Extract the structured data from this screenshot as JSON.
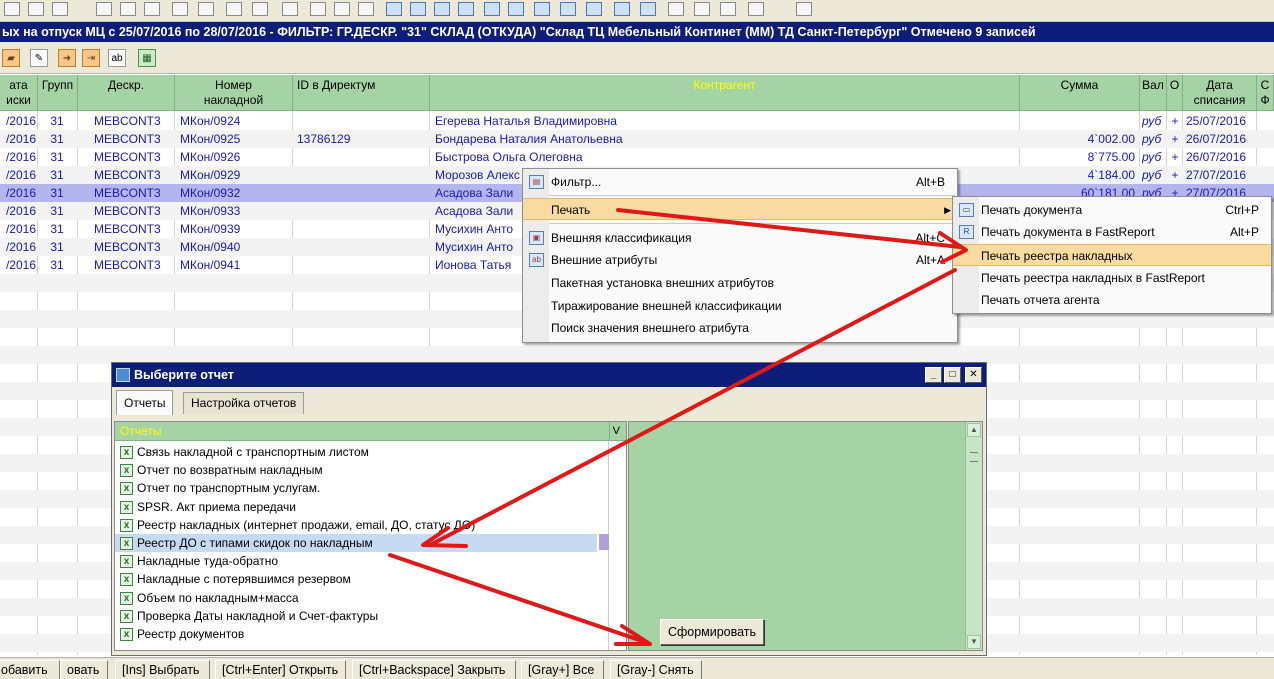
{
  "window": {
    "title": "ых на отпуск МЦ с 25/07/2016 по 28/07/2016 - ФИЛЬТР:  ГР.ДЕСКР. \"31\"  СКЛАД (ОТКУДА) \"Склад ТЦ Мебельный Континет (ММ) ТД Санкт-Петербург\"  Отмечено 9 записей"
  },
  "grid": {
    "headers": {
      "date": "ата\nиски",
      "group": "Групп",
      "descr": "Дескр.",
      "number": "Номер\nнакладной",
      "directum": "ID в Директум",
      "contragent": "Контрагент",
      "sum": "Сумма",
      "cur": "Вал",
      "o": "О",
      "wdate": "Дата\nсписания",
      "cf": "С\nФ"
    },
    "rows": [
      {
        "date": "/2016",
        "group": "31",
        "descr": "MEBCONT3",
        "number": "МКон/0924",
        "directum": "",
        "contragent": "Егерева Наталья Владимировна",
        "sum": "",
        "cur": "руб",
        "o": "+",
        "wdate": "25/07/2016"
      },
      {
        "date": "/2016",
        "group": "31",
        "descr": "MEBCONT3",
        "number": "МКон/0925",
        "directum": "13786129",
        "contragent": "Бондарева Наталия Анатольевна",
        "sum": "4`002.00",
        "cur": "руб",
        "o": "+",
        "wdate": "26/07/2016"
      },
      {
        "date": "/2016",
        "group": "31",
        "descr": "MEBCONT3",
        "number": "МКон/0926",
        "directum": "",
        "contragent": "Быстрова Ольга Олеговна",
        "sum": "8`775.00",
        "cur": "руб",
        "o": "+",
        "wdate": "26/07/2016"
      },
      {
        "date": "/2016",
        "group": "31",
        "descr": "MEBCONT3",
        "number": "МКон/0929",
        "directum": "",
        "contragent": "Морозов Алекс",
        "sum": "4`184.00",
        "cur": "руб",
        "o": "+",
        "wdate": "27/07/2016"
      },
      {
        "date": "/2016",
        "group": "31",
        "descr": "MEBCONT3",
        "number": "МКон/0932",
        "directum": "",
        "contragent": "Асадова Зали",
        "sum": "60`181.00",
        "cur": "руб",
        "o": "+",
        "wdate": "27/07/2016"
      },
      {
        "date": "/2016",
        "group": "31",
        "descr": "MEBCONT3",
        "number": "МКон/0933",
        "directum": "",
        "contragent": "Асадова Зали",
        "sum": "",
        "cur": "",
        "o": "",
        "wdate": ""
      },
      {
        "date": "/2016",
        "group": "31",
        "descr": "MEBCONT3",
        "number": "МКон/0939",
        "directum": "",
        "contragent": "Мусихин Анто",
        "sum": "",
        "cur": "",
        "o": "",
        "wdate": ""
      },
      {
        "date": "/2016",
        "group": "31",
        "descr": "MEBCONT3",
        "number": "МКон/0940",
        "directum": "",
        "contragent": "Мусихин Анто",
        "sum": "",
        "cur": "",
        "o": "",
        "wdate": ""
      },
      {
        "date": "/2016",
        "group": "31",
        "descr": "MEBCONT3",
        "number": "МКон/0941",
        "directum": "",
        "contragent": "Ионова Татья",
        "sum": "",
        "cur": "",
        "o": "",
        "wdate": ""
      }
    ]
  },
  "context_menu": {
    "items": [
      {
        "label": "Фильтр...",
        "shortcut": "Alt+B",
        "icon": "filter-icon"
      },
      {
        "label": "Печать",
        "shortcut": "",
        "icon": "",
        "submenu_arrow": "▶"
      },
      {
        "label": "Внешняя классификация",
        "shortcut": "Alt+C",
        "icon": "classification-icon"
      },
      {
        "label": "Внешние атрибуты",
        "shortcut": "Alt+A",
        "icon": "attributes-icon",
        "icon_text": "ab"
      },
      {
        "label": "Пакетная установка внешних атрибутов",
        "shortcut": ""
      },
      {
        "label": "Тиражирование внешней классификации",
        "shortcut": ""
      },
      {
        "label": "Поиск значения внешнего атрибута",
        "shortcut": ""
      }
    ]
  },
  "submenu": {
    "items": [
      {
        "label": "Печать документа",
        "shortcut": "Ctrl+P",
        "icon": "printer-icon"
      },
      {
        "label": "Печать документа в FastReport",
        "shortcut": "Alt+P",
        "icon": "fastreport-icon"
      },
      {
        "label": "Печать реестра накладных",
        "shortcut": ""
      },
      {
        "label": "Печать реестра накладных в FastReport",
        "shortcut": ""
      },
      {
        "label": "Печать отчета агента",
        "shortcut": ""
      }
    ]
  },
  "dialog": {
    "title": "Выберите отчет",
    "tabs": [
      "Отчеты",
      "Настройка отчетов"
    ],
    "list_header": "Отчеты",
    "list_col_v": "V",
    "items": [
      "Связь накладной с транспортным листом",
      "Отчет по возвратным накладным",
      "Отчет по транспортным услугам.",
      "SPSR. Акт приема передачи",
      "Реестр накладных (интернет продажи, email, ДО, статус ДО)",
      "Реестр ДО с типами скидок по накладным",
      "Накладные туда-обратно",
      "Накладные с потерявшимся резервом",
      "Объем по накладным+масса",
      "Проверка Даты накладной и Счет-фактуры",
      "Реестр документов"
    ],
    "selected_index": 5,
    "form_button": "Сформировать",
    "win_buttons": {
      "minimize": "_",
      "maximize": "□",
      "close": "✕"
    }
  },
  "bottombar": {
    "buttons": [
      "обавить",
      "овать",
      "[Ins] Выбрать",
      "[Ctrl+Enter] Открыть",
      "[Ctrl+Backspace] Закрыть",
      "[Gray+] Все",
      "[Gray-] Снять"
    ]
  },
  "colors": {
    "title_bg": "#0c1d7a",
    "grid_header": "#a6d3a6",
    "link_text": "#1818b8",
    "menu_highlight": "#f8dba0",
    "arrow": "#e01818"
  }
}
